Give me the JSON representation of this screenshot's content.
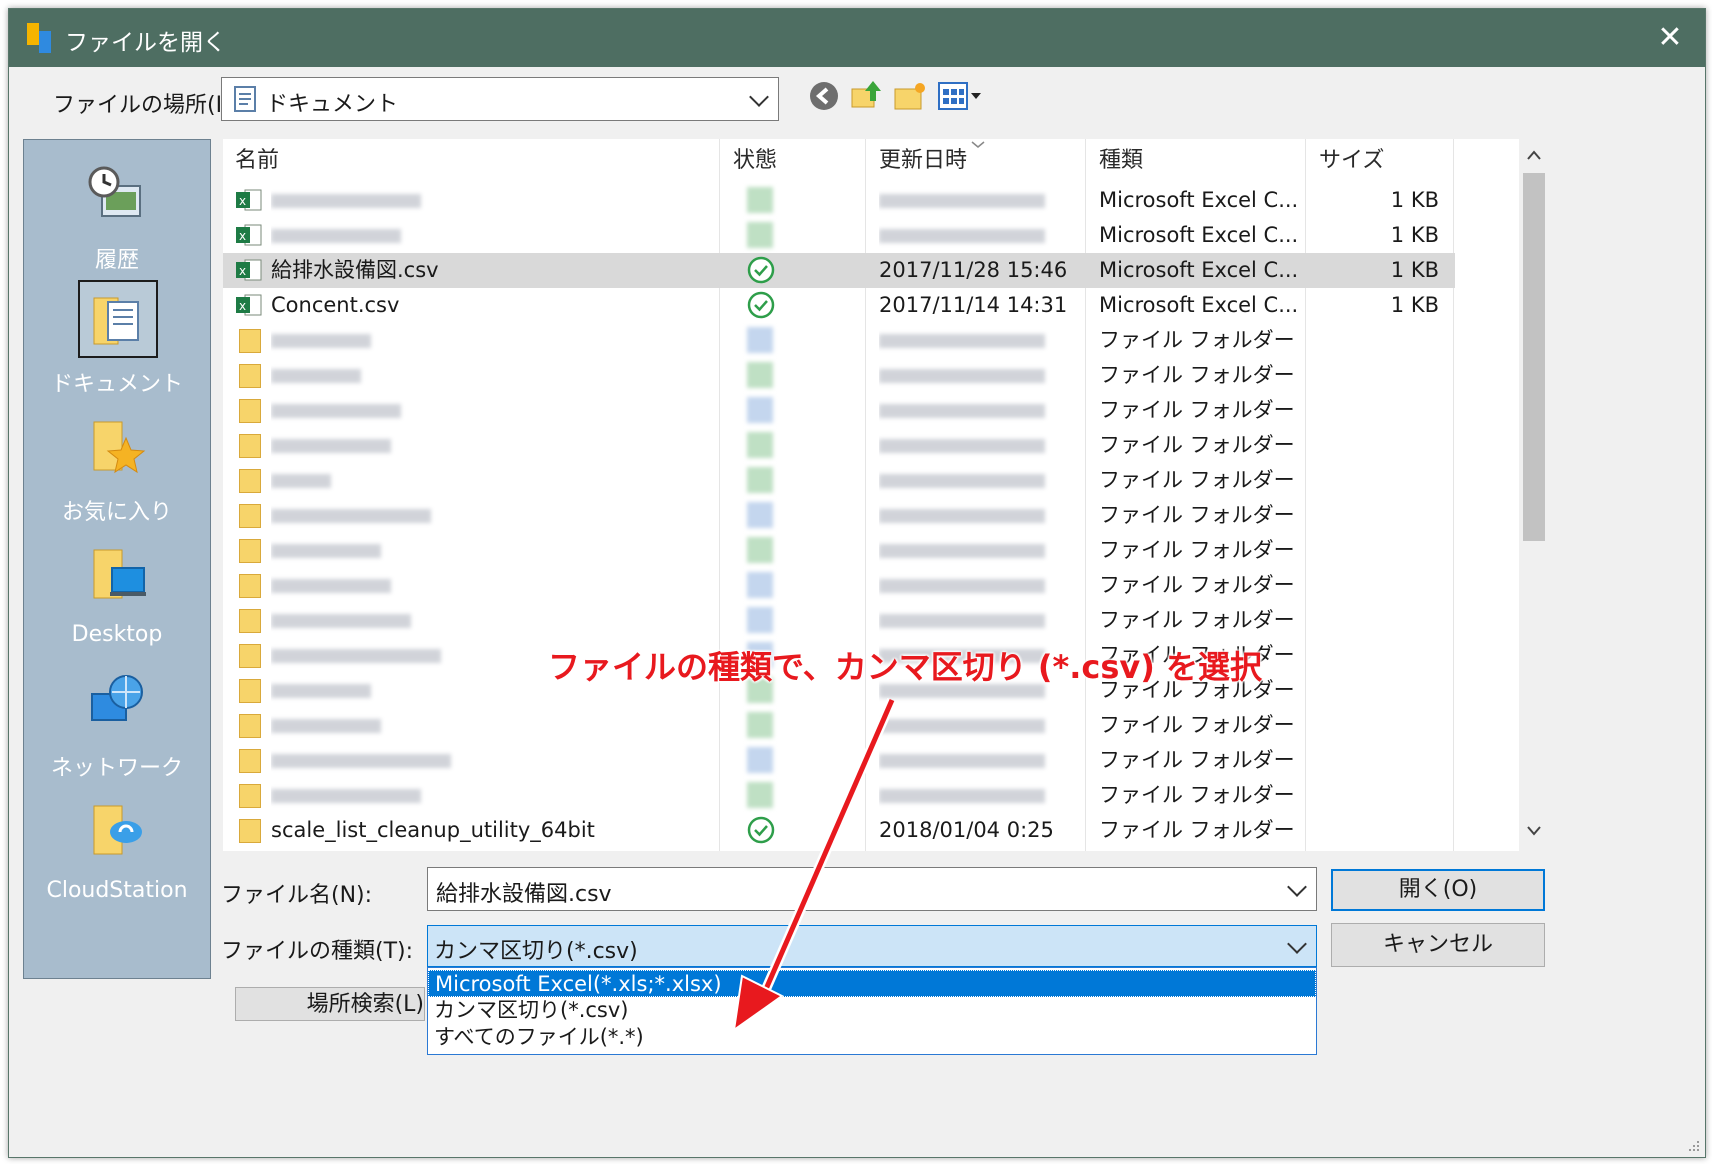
{
  "window": {
    "title": "ファイルを開く",
    "close_glyph": "✕"
  },
  "location": {
    "label": "ファイルの場所(I):",
    "value": "ドキュメント"
  },
  "places": [
    {
      "label": "履歴"
    },
    {
      "label": "ドキュメント"
    },
    {
      "label": "お気に入り"
    },
    {
      "label": "Desktop"
    },
    {
      "label": "ネットワーク"
    },
    {
      "label": "CloudStation"
    }
  ],
  "columns": {
    "name": "名前",
    "status": "状態",
    "modified": "更新日時",
    "type": "種類",
    "size": "サイズ"
  },
  "files": [
    {
      "name": "",
      "status": "",
      "modified": "",
      "type": "Microsoft Excel C...",
      "size": "1 KB",
      "kind": "excel",
      "blurred": true
    },
    {
      "name": "",
      "status": "",
      "modified": "",
      "type": "Microsoft Excel C...",
      "size": "1 KB",
      "kind": "excel",
      "blurred": true
    },
    {
      "name": "給排水設備図.csv",
      "status": "synced",
      "modified": "2017/11/28 15:46",
      "type": "Microsoft Excel C...",
      "size": "1 KB",
      "kind": "excel",
      "blurred": false,
      "selected": true
    },
    {
      "name": "Concent.csv",
      "status": "synced",
      "modified": "2017/11/14 14:31",
      "type": "Microsoft Excel C...",
      "size": "1 KB",
      "kind": "excel",
      "blurred": false
    },
    {
      "name": "",
      "modified": "",
      "type": "ファイル フォルダー",
      "size": "",
      "kind": "folder",
      "blurred": true,
      "tint": "b"
    },
    {
      "name": "",
      "modified": "",
      "type": "ファイル フォルダー",
      "size": "",
      "kind": "folder",
      "blurred": true,
      "tint": "g"
    },
    {
      "name": "",
      "modified": "",
      "type": "ファイル フォルダー",
      "size": "",
      "kind": "folder",
      "blurred": true,
      "tint": "b"
    },
    {
      "name": "",
      "modified": "",
      "type": "ファイル フォルダー",
      "size": "",
      "kind": "folder",
      "blurred": true,
      "tint": "g"
    },
    {
      "name": "",
      "modified": "",
      "type": "ファイル フォルダー",
      "size": "",
      "kind": "folder",
      "blurred": true,
      "tint": "g"
    },
    {
      "name": "",
      "modified": "",
      "type": "ファイル フォルダー",
      "size": "",
      "kind": "folder",
      "blurred": true,
      "tint": "b"
    },
    {
      "name": "",
      "modified": "",
      "type": "ファイル フォルダー",
      "size": "",
      "kind": "folder",
      "blurred": true,
      "tint": "g"
    },
    {
      "name": "",
      "modified": "",
      "type": "ファイル フォルダー",
      "size": "",
      "kind": "folder",
      "blurred": true,
      "tint": "b"
    },
    {
      "name": "",
      "modified": "",
      "type": "ファイル フォルダー",
      "size": "",
      "kind": "folder",
      "blurred": true,
      "tint": "b"
    },
    {
      "name": "",
      "modified": "",
      "type": "ファイル フォルダー",
      "size": "",
      "kind": "folder",
      "blurred": true,
      "tint": "b"
    },
    {
      "name": "",
      "modified": "",
      "type": "ファイル フォルダー",
      "size": "",
      "kind": "folder",
      "blurred": true,
      "tint": "g"
    },
    {
      "name": "",
      "modified": "",
      "type": "ファイル フォルダー",
      "size": "",
      "kind": "folder",
      "blurred": true,
      "tint": "g"
    },
    {
      "name": "",
      "modified": "",
      "type": "ファイル フォルダー",
      "size": "",
      "kind": "folder",
      "blurred": true,
      "tint": "b"
    },
    {
      "name": "",
      "modified": "",
      "type": "ファイル フォルダー",
      "size": "",
      "kind": "folder",
      "blurred": true,
      "tint": "g"
    },
    {
      "name": "scale_list_cleanup_utility_64bit",
      "status": "synced",
      "modified": "2018/01/04 0:25",
      "type": "ファイル フォルダー",
      "size": "",
      "kind": "folder",
      "blurred": false
    }
  ],
  "filename": {
    "label": "ファイル名(N):",
    "value": "給排水設備図.csv"
  },
  "filetype": {
    "label": "ファイルの種類(T):",
    "value": "カンマ区切り(*.csv)",
    "options": [
      "Microsoft Excel(*.xls;*.xlsx)",
      "カンマ区切り(*.csv)",
      "すべてのファイル(*.*)"
    ],
    "highlighted_index": 0
  },
  "buttons": {
    "open": "開く(O)",
    "cancel": "キャンセル",
    "search": "場所検索(L)"
  },
  "annotation": {
    "text": "ファイルの種類で、カンマ区切り (*.csv) を選択",
    "color": "#e8191e"
  },
  "colors": {
    "titlebar": "#4e6e62",
    "places_panel": "#a8bccd",
    "selection": "#0078d7",
    "selected_row": "#d9d9d9"
  }
}
